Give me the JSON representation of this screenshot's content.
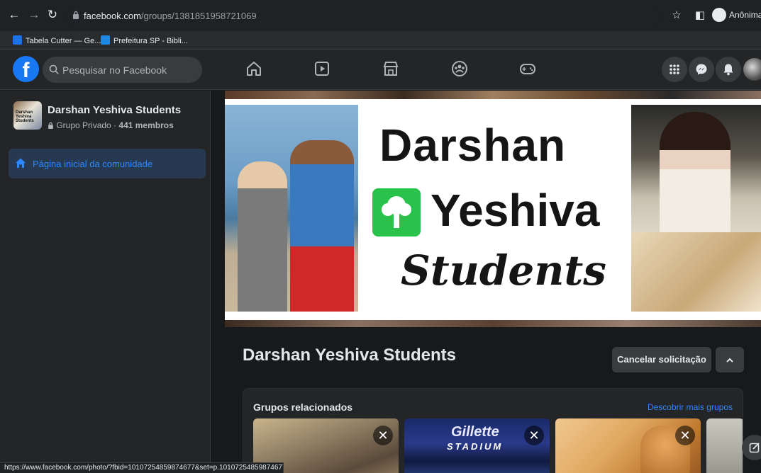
{
  "browser": {
    "url_host": "facebook.com",
    "url_path": "/groups/1381851958721069",
    "profile_label": "Anônima",
    "bookmarks": [
      {
        "label": "Tabela Cutter — Ge...",
        "color": "#1a73e8"
      },
      {
        "label": "Prefeitura SP - Bibli...",
        "color": "#1e88e5"
      }
    ],
    "status_url": "https://www.facebook.com/photo/?fbid=10107254859874677&set=p.10107254859874677"
  },
  "fb": {
    "logo": "f",
    "search_placeholder": "Pesquisar no Facebook",
    "nav_icons": [
      "home-icon",
      "watch-icon",
      "marketplace-icon",
      "groups-icon",
      "gaming-icon"
    ],
    "right_icons": [
      "menu-grid-icon",
      "messenger-icon",
      "notifications-icon"
    ],
    "accent": "#1877f2"
  },
  "sidebar": {
    "group_name": "Darshan Yeshiva Students",
    "privacy": "Grupo Privado",
    "members": "441 membros",
    "thumb_text": "Darshan Yeshiva Students",
    "item_label": "Página inicial da comunidade"
  },
  "cover": {
    "line1": "Darshan",
    "line2": "Yeshiva",
    "line3": "Students"
  },
  "main": {
    "title": "Darshan Yeshiva Students",
    "cancel_label": "Cancelar solicitação",
    "related_title": "Grupos relacionados",
    "related_link": "Descobrir mais grupos",
    "card2_brand": "Gillette",
    "card2_stadium": "STADIUM",
    "card_close": "✕"
  }
}
